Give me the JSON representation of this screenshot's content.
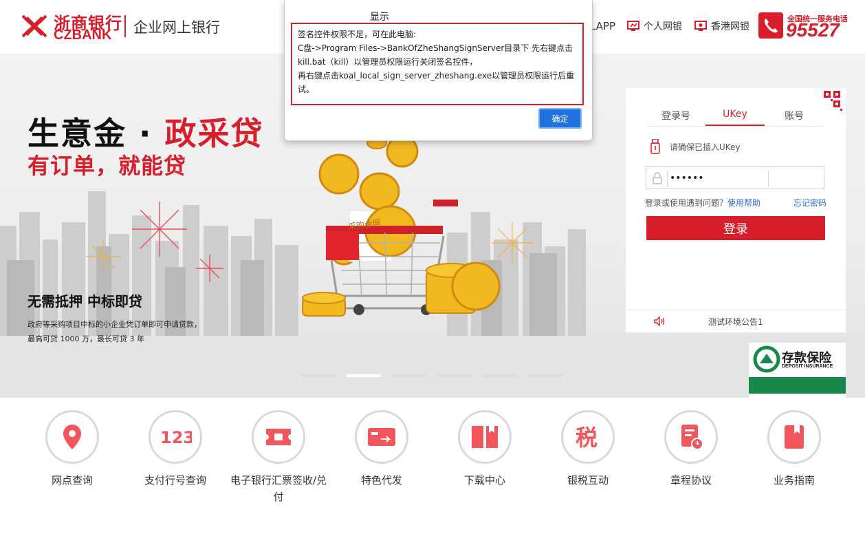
{
  "header": {
    "logo_cn": "浙商银行",
    "logo_en": "CZBANK",
    "portal": "企业网上银行",
    "nav_app": "LAPP",
    "nav_personal": "个人网银",
    "nav_hk": "香港网银",
    "hotline_label": "全国统一服务电话",
    "hotline_number": "95527"
  },
  "banner": {
    "title_black": "生意金 · ",
    "title_red": "政采贷",
    "subtitle": "有订单，就能贷",
    "tagline": "无需抵押   中标即贷",
    "desc": "政府等采购项目中标的小企业凭订单即可申请贷款，最高可贷 1000 万，最长可贷 3 年",
    "cart_label": "采购合同",
    "active_slide": 2,
    "slide_count": 6
  },
  "login": {
    "tabs": [
      "登录号",
      "UKey",
      "账号"
    ],
    "active_tab": "UKey",
    "ukey_hint": "请确保已插入UKey",
    "password_mask": "••••••",
    "help_text": "登录或使用遇到问题？",
    "help_link": "使用帮助",
    "forgot": "忘记密码",
    "login_button": "登录",
    "notice": "测试环境公告1"
  },
  "deposit": {
    "title": "存款保险",
    "en": "DEPOSIT INSURANCE"
  },
  "modal": {
    "title": "显示",
    "line1": "签名控件权限不足，可在此电脑:",
    "line2": "C盘->Program Files->BankOfZheShangSignServer目录下 先右键点击kill.bat（kill）以管理员权限运行关闭签名控件，",
    "line3": "再右键点击koal_local_sign_server_zheshang.exe以管理员权限运行后重试。",
    "ok_button": "确定"
  },
  "services": [
    {
      "label": "网点查询",
      "icon": "location-pin-icon"
    },
    {
      "label": "支付行号查询",
      "icon": "number-123-icon"
    },
    {
      "label": "电子银行汇票签收/兑付",
      "icon": "ticket-icon"
    },
    {
      "label": "特色代发",
      "icon": "card-transfer-icon"
    },
    {
      "label": "下载中心",
      "icon": "book-download-icon"
    },
    {
      "label": "银税互动",
      "icon": "tax-icon"
    },
    {
      "label": "章程协议",
      "icon": "document-clock-icon"
    },
    {
      "label": "业务指南",
      "icon": "bookmark-book-icon"
    }
  ],
  "colors": {
    "brand_red": "#d81e2b",
    "service_icon_red": "#f2555c",
    "link_blue": "#2f6bc9",
    "ok_blue": "#1f73e0",
    "deposit_green": "#17874b"
  }
}
